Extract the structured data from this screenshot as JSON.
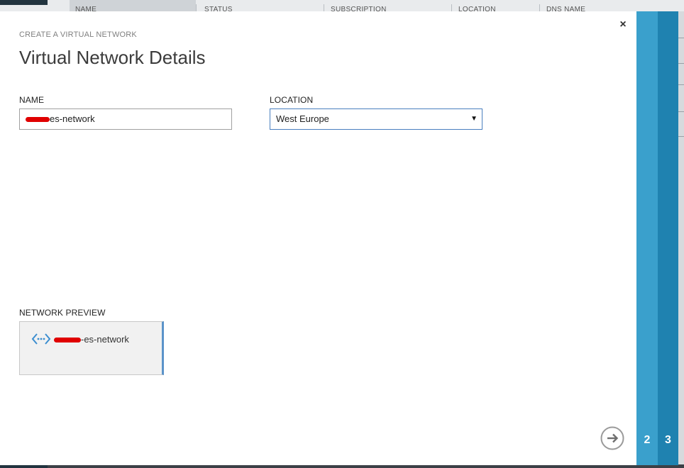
{
  "background": {
    "columns": [
      "NAME",
      "STATUS",
      "SUBSCRIPTION",
      "LOCATION",
      "DNS NAME"
    ]
  },
  "dialog": {
    "subtitle": "CREATE A VIRTUAL NETWORK",
    "title": "Virtual Network Details",
    "close_label": "×",
    "name_label": "NAME",
    "name_value": "es-network",
    "location_label": "LOCATION",
    "location_value": "West Europe",
    "preview_label": "NETWORK PREVIEW",
    "preview_network_name": "-es-network",
    "icons": {
      "close": "close-icon",
      "dropdown": "chevron-down-icon",
      "network": "virtual-network-icon",
      "next": "arrow-right-icon"
    }
  },
  "steps": [
    {
      "number": "2"
    },
    {
      "number": "3"
    }
  ],
  "colors": {
    "accent_step2": "#3aa0cc",
    "accent_step3": "#1f82b0",
    "select_border": "#4a7fbf",
    "redaction": "#e00000"
  }
}
